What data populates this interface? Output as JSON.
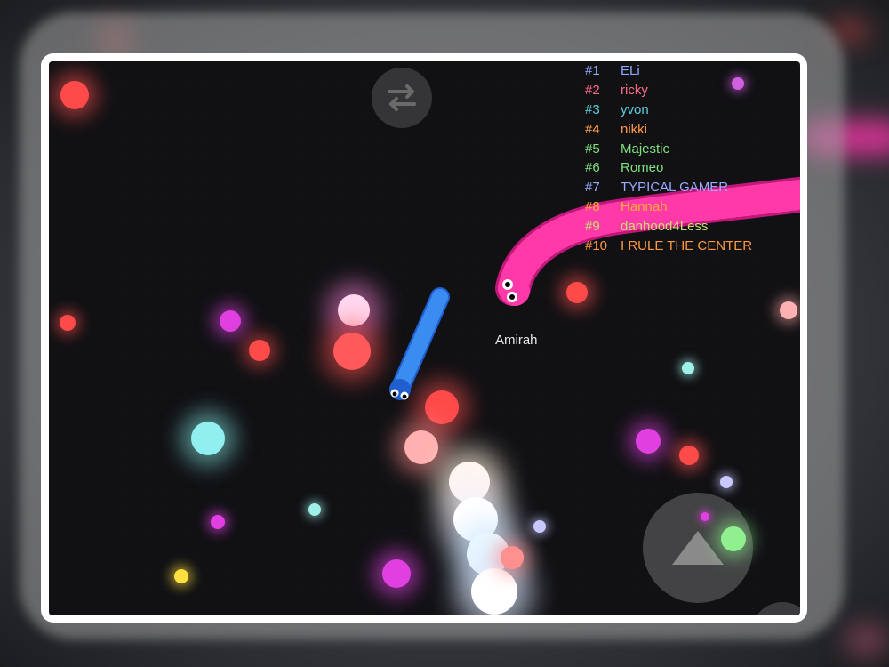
{
  "leaderboard": [
    {
      "rank": "#1",
      "name": "ELi",
      "color": "#8fa8ff"
    },
    {
      "rank": "#2",
      "name": "ricky",
      "color": "#ff6a8a"
    },
    {
      "rank": "#3",
      "name": "yvon",
      "color": "#5fd0e0"
    },
    {
      "rank": "#4",
      "name": "nikki",
      "color": "#ff9a4a"
    },
    {
      "rank": "#5",
      "name": "Majestic",
      "color": "#7fe07f"
    },
    {
      "rank": "#6",
      "name": "Romeo",
      "color": "#7fe07f"
    },
    {
      "rank": "#7",
      "name": "TYPICAL GAMER",
      "color": "#9aaaff"
    },
    {
      "rank": "#8",
      "name": "Hannah",
      "color": "#ffb030"
    },
    {
      "rank": "#9",
      "name": "danhood4Less",
      "color": "#c8e070"
    },
    {
      "rank": "#10",
      "name": "I RULE THE CENTER",
      "color": "#ff9a40"
    }
  ],
  "player": {
    "name": "Amirah"
  },
  "snakes": {
    "player_color": "#2a6fe0",
    "enemy_color": "#ff3aa8"
  },
  "controls": {
    "swap_icon": "swap-arrows-icon",
    "joystick_icon": "up-triangle-icon"
  }
}
